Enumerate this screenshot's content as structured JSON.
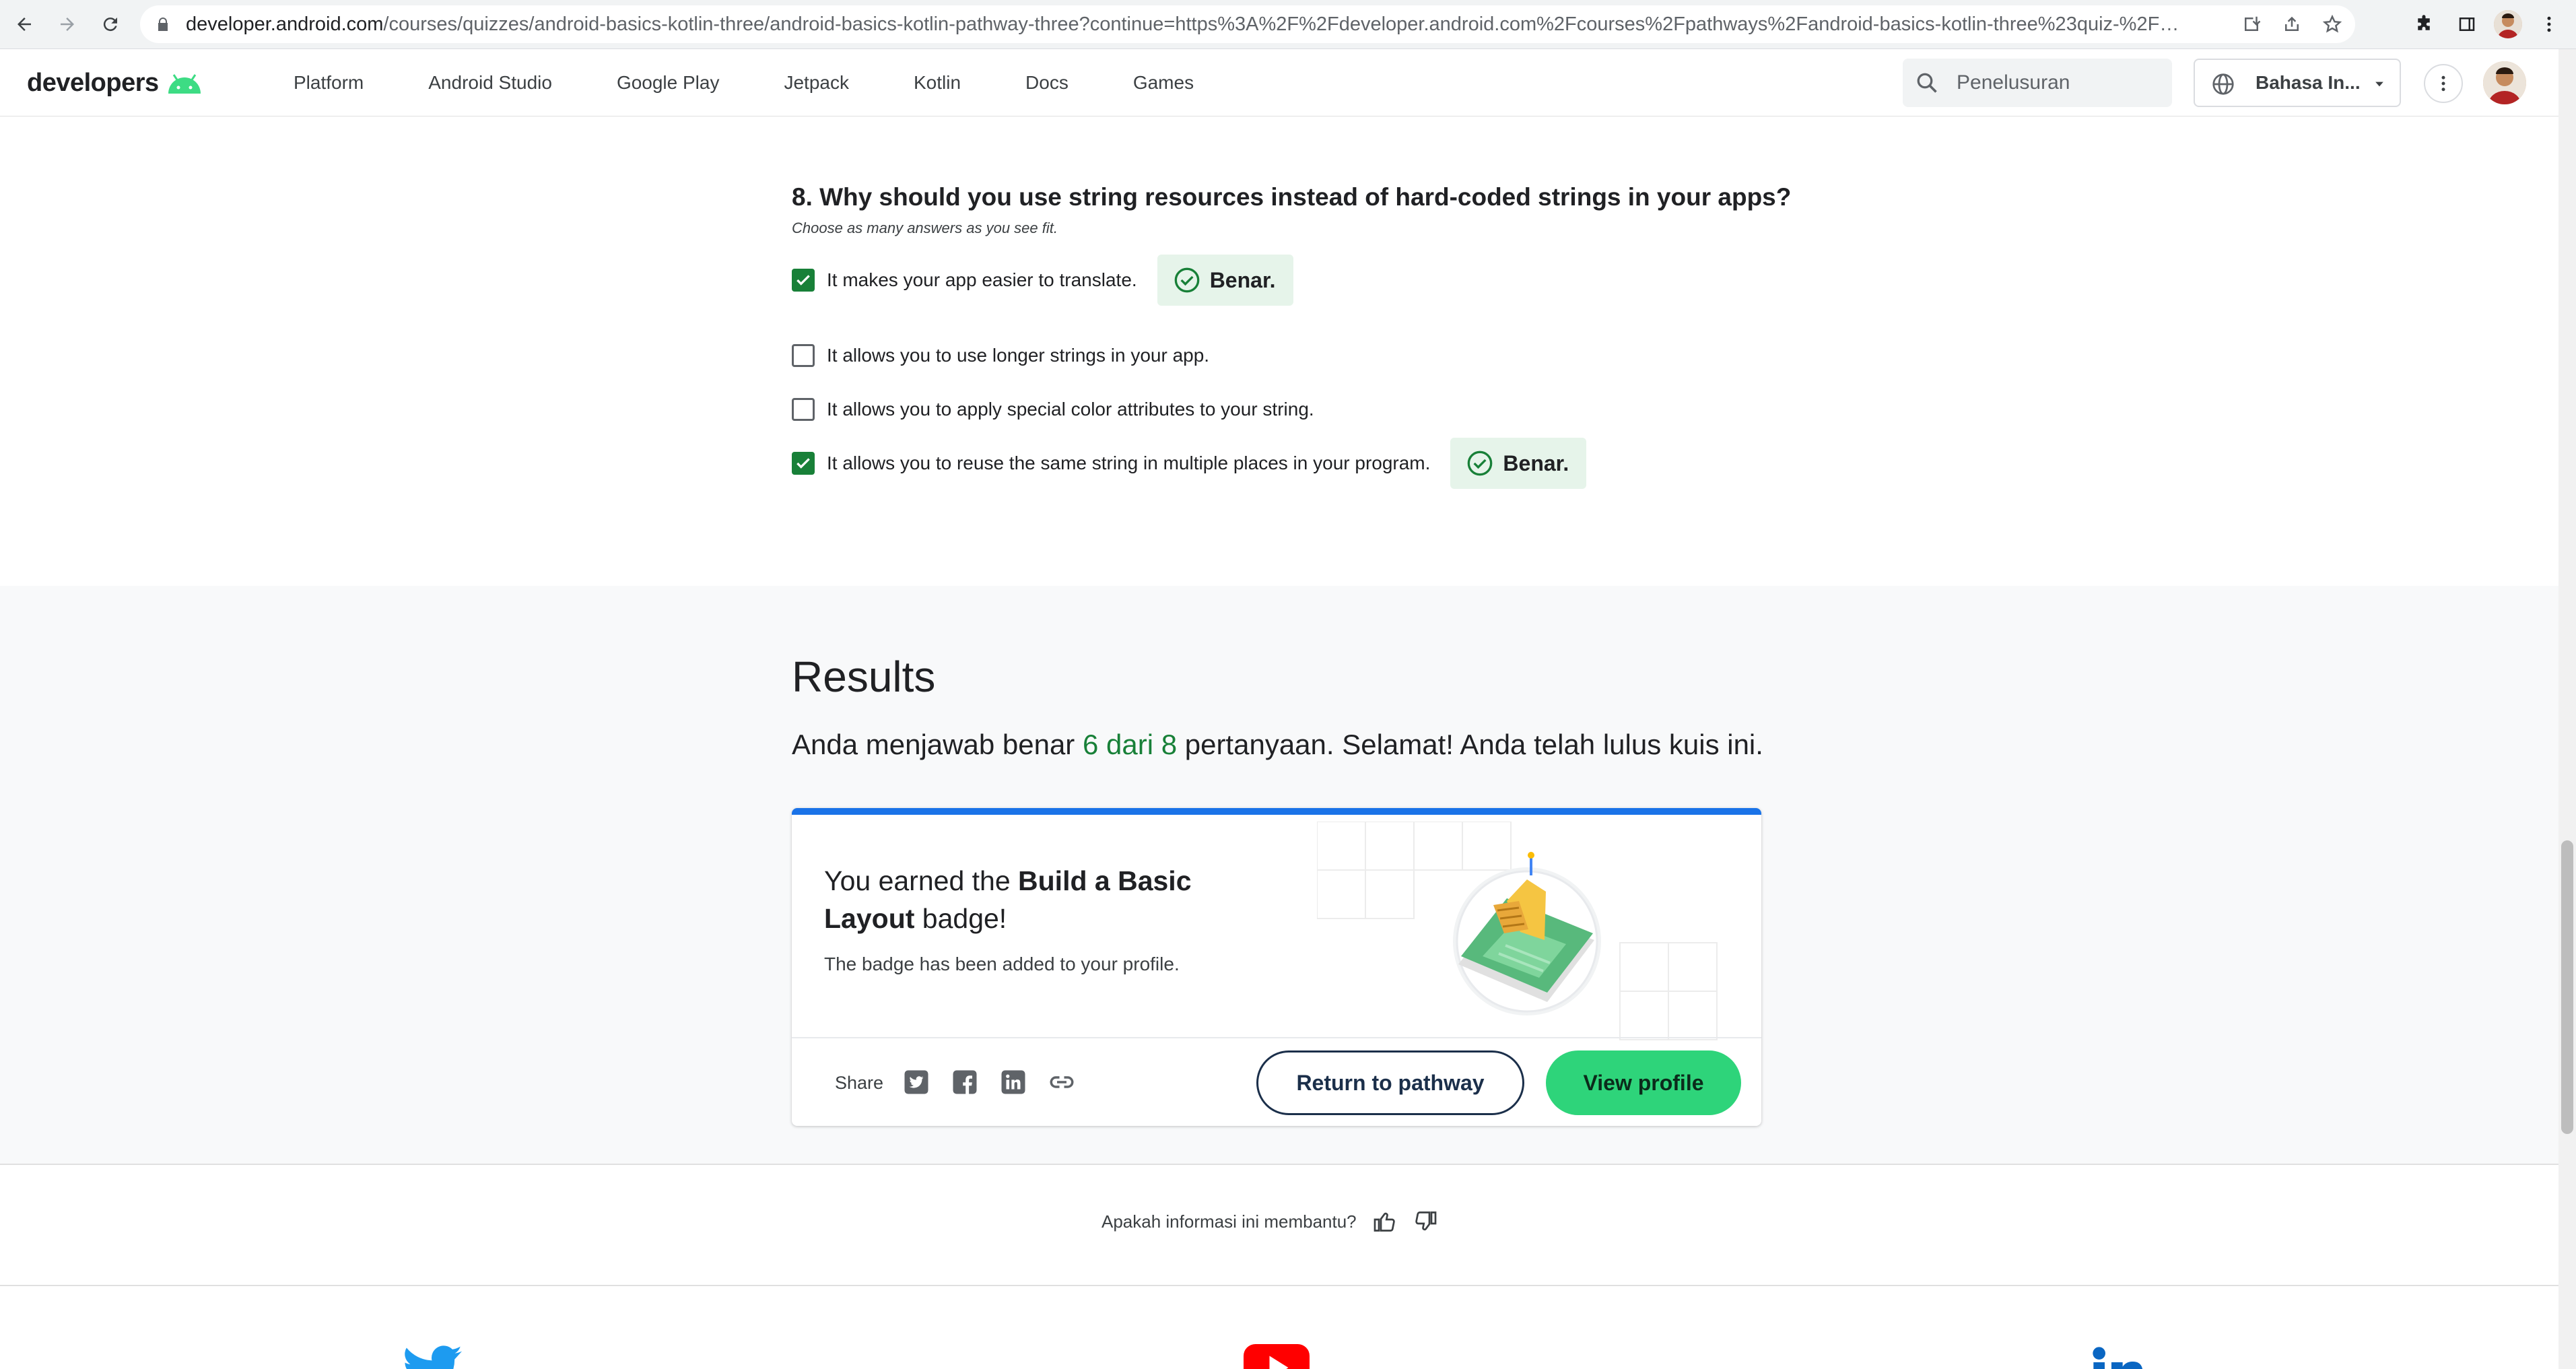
{
  "browser": {
    "url_host": "developer.android.com",
    "url_path": "/courses/quizzes/android-basics-kotlin-three/android-basics-kotlin-pathway-three?continue=https%3A%2F%2Fdeveloper.android.com%2Fcourses%2Fpathways%2Fandroid-basics-kotlin-three%23quiz-%2Fcourses%2Fquizze..."
  },
  "header": {
    "logo_text": "developers",
    "nav": [
      "Platform",
      "Android Studio",
      "Google Play",
      "Jetpack",
      "Kotlin",
      "Docs",
      "Games"
    ],
    "search_placeholder": "Penelusuran",
    "language": "Bahasa In..."
  },
  "question": {
    "title": "8. Why should you use string resources instead of hard-coded strings in your apps?",
    "hint": "Choose as many answers as you see fit.",
    "options": [
      {
        "label": "It makes your app easier to translate.",
        "checked": true,
        "feedback": "Benar."
      },
      {
        "label": "It allows you to use longer strings in your app.",
        "checked": false,
        "feedback": ""
      },
      {
        "label": "It allows you to apply special color attributes to your string.",
        "checked": false,
        "feedback": ""
      },
      {
        "label": "It allows you to reuse the same string in multiple places in your program.",
        "checked": true,
        "feedback": "Benar."
      }
    ]
  },
  "results": {
    "title": "Results",
    "line_before": "Anda menjawab benar ",
    "score": "6 dari 8",
    "line_after": " pertanyaan. Selamat! Anda telah lulus kuis ini."
  },
  "badge_card": {
    "heading_prefix": "You earned the ",
    "badge_name": "Build a Basic Layout",
    "heading_suffix": " badge!",
    "subtext": "The badge has been added to your profile.",
    "share_label": "Share",
    "return_button": "Return to pathway",
    "profile_button": "View profile"
  },
  "feedback": {
    "question": "Apakah informasi ini membantu?"
  },
  "colors": {
    "accent_green": "#188038",
    "button_green": "#2ed47a",
    "card_bar_blue": "#1a73e8",
    "correct_bg": "#e6f4ea"
  },
  "icons": [
    "back-icon",
    "forward-icon",
    "reload-icon",
    "lock-icon",
    "install-icon",
    "share-icon",
    "star-icon",
    "extensions-icon",
    "sidepanel-icon",
    "menu-icon",
    "search-icon",
    "globe-icon",
    "check-circle-icon",
    "twitter-icon",
    "facebook-icon",
    "linkedin-icon",
    "link-icon",
    "thumb-up-icon",
    "thumb-down-icon",
    "youtube-icon"
  ]
}
